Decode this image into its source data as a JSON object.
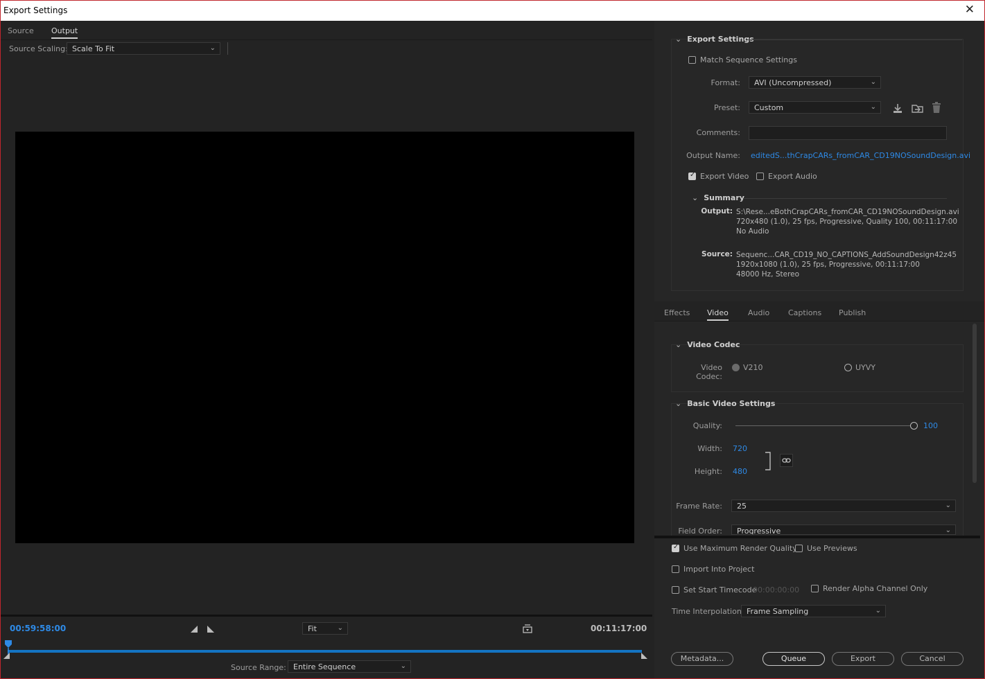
{
  "window": {
    "title": "Export Settings",
    "close_icon": "✕"
  },
  "left": {
    "tabs": [
      "Source",
      "Output"
    ],
    "active_tab": "Output",
    "source_scaling_label": "Source Scaling:",
    "source_scaling_value": "Scale To Fit",
    "current_time": "00:59:58:00",
    "duration": "00:11:17:00",
    "zoom_value": "Fit",
    "source_range_label": "Source Range:",
    "source_range_value": "Entire Sequence"
  },
  "export_settings": {
    "header": "Export Settings",
    "match_sequence_label": "Match Sequence Settings",
    "match_sequence_checked": false,
    "format_label": "Format:",
    "format_value": "AVI (Uncompressed)",
    "preset_label": "Preset:",
    "preset_value": "Custom",
    "comments_label": "Comments:",
    "comments_value": "",
    "output_name_label": "Output Name:",
    "output_name_value": "editedS...thCrapCARs_fromCAR_CD19NOSoundDesign.avi",
    "export_video_label": "Export Video",
    "export_video_checked": true,
    "export_audio_label": "Export Audio",
    "export_audio_checked": false
  },
  "summary": {
    "header": "Summary",
    "output_label": "Output:",
    "output_lines": [
      "S:\\Rese...eBothCrapCARs_fromCAR_CD19NOSoundDesign.avi",
      "720x480 (1.0), 25 fps, Progressive, Quality 100, 00:11:17:00",
      "No Audio"
    ],
    "source_label": "Source:",
    "source_lines": [
      "Sequenc...CAR_CD19_NO_CAPTIONS_AddSoundDesign42z45",
      "1920x1080 (1.0), 25 fps, Progressive, 00:11:17:00",
      "48000 Hz, Stereo"
    ]
  },
  "settings_tabs": [
    "Effects",
    "Video",
    "Audio",
    "Captions",
    "Publish"
  ],
  "active_settings_tab": "Video",
  "video_codec": {
    "header": "Video Codec",
    "label": "Video Codec:",
    "options": [
      "V210",
      "UYVY"
    ],
    "selected": "V210"
  },
  "basic_video": {
    "header": "Basic Video Settings",
    "quality_label": "Quality:",
    "quality_value": "100",
    "quality_fraction": 1.0,
    "width_label": "Width:",
    "width_value": "720",
    "height_label": "Height:",
    "height_value": "480",
    "frame_rate_label": "Frame Rate:",
    "frame_rate_value": "25",
    "field_order_label": "Field Order:",
    "field_order_value": "Progressive"
  },
  "render_options": {
    "max_render_quality_label": "Use Maximum Render Quality",
    "max_render_quality_checked": true,
    "use_previews_label": "Use Previews",
    "use_previews_checked": false,
    "import_into_project_label": "Import Into Project",
    "import_into_project_checked": false,
    "set_start_timecode_label": "Set Start Timecode",
    "set_start_timecode_checked": false,
    "start_timecode_value": "00:00:00:00",
    "render_alpha_label": "Render Alpha Channel Only",
    "render_alpha_checked": false,
    "time_interpolation_label": "Time Interpolation:",
    "time_interpolation_value": "Frame Sampling"
  },
  "buttons": {
    "metadata": "Metadata...",
    "queue": "Queue",
    "export": "Export",
    "cancel": "Cancel"
  },
  "icons": {
    "chevron": "⌄",
    "save_preset": "save-preset-icon",
    "import_preset": "import-preset-icon",
    "delete_preset": "trash-icon",
    "link": "link-icon"
  }
}
